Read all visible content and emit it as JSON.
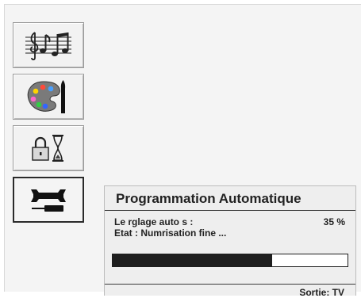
{
  "menu": {
    "items": [
      {
        "name": "sound",
        "icon": "music-notes-icon",
        "selected": false
      },
      {
        "name": "picture",
        "icon": "palette-brush-icon",
        "selected": false
      },
      {
        "name": "features",
        "icon": "lock-hourglass-icon",
        "selected": false
      },
      {
        "name": "installation",
        "icon": "wrench-screwdriver-icon",
        "selected": true
      }
    ]
  },
  "dialog": {
    "title": "Programmation Automatique",
    "line1": "Le rglage auto s :",
    "line2": "Etat : Numrisation fine ...",
    "percent_label": "35 %",
    "progress": 0.68,
    "exit_hint": "Sortie: TV"
  },
  "colors": {
    "background": "#f4f4f4",
    "progress_fill": "#1e1e1e",
    "progress_track": "#ffffff"
  }
}
